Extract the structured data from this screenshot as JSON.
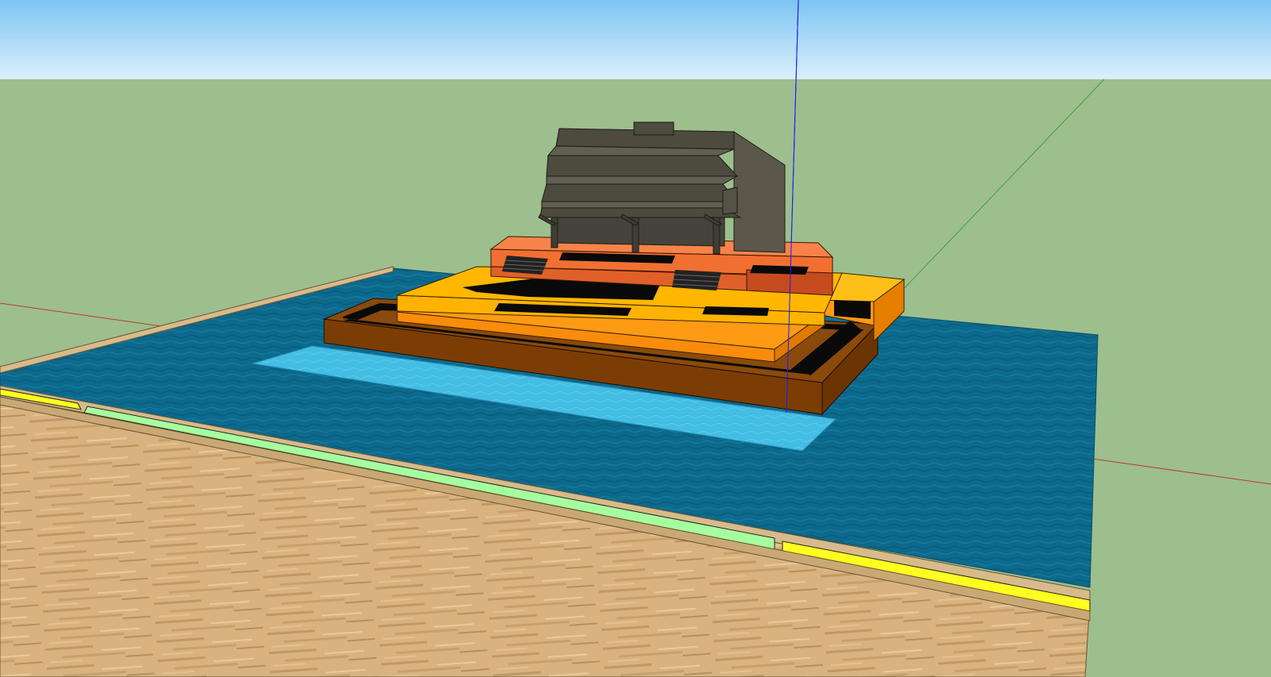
{
  "app": {
    "type": "3d-modeling-viewport",
    "camera": "perspective"
  },
  "colors": {
    "sky_top": "#7dc4f2",
    "sky_bottom": "#d7eefb",
    "ground": "#9cbf8d",
    "water": "#0c6a8e",
    "water_light": "#45bfe6",
    "wood_light": "#dcb784",
    "wood_dark": "#b8925e",
    "edge_tan": "#d7bb8a",
    "pier_brown": "#7c3d04",
    "pier_orange": "#f58a0c",
    "deck_yellow": "#ffb300",
    "deck_yellow_light": "#ffc21c",
    "upper_red": "#f77537",
    "upper_red_dark": "#c64b1f",
    "building_dark": "#4d4a3e",
    "building_mid": "#5b584b",
    "building_light": "#625f52",
    "black": "#0a0a0a",
    "yellow_stripe": "#ffff1f",
    "green_stripe": "#a6ff9e",
    "axis_red": "#c0392b",
    "axis_green": "#4caf50",
    "axis_blue": "#1a1aff"
  },
  "scene_objects": [
    "sky",
    "ground-plane",
    "water-surface",
    "boardwalk",
    "shallow-pool",
    "pier-base",
    "lower-deck",
    "upper-terrace",
    "house",
    "axis-lines"
  ]
}
